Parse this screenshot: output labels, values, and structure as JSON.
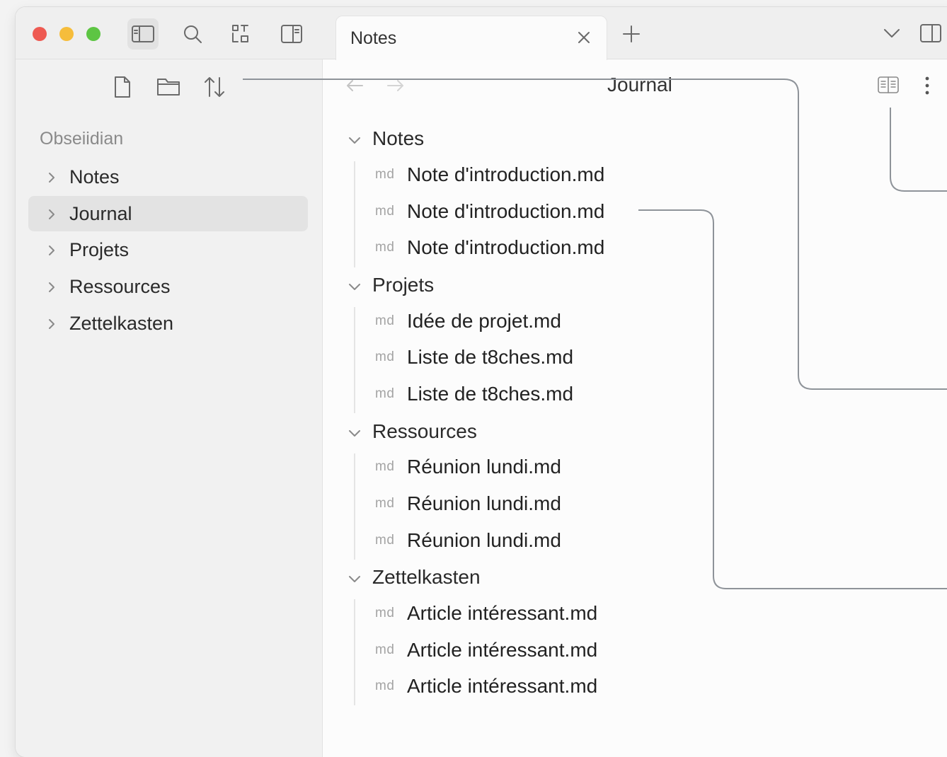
{
  "tab": {
    "title": "Notes"
  },
  "header": {
    "title": "Journal"
  },
  "sidebar": {
    "vault_name": "Obseiidian",
    "items": [
      {
        "label": "Notes",
        "selected": false
      },
      {
        "label": "Journal",
        "selected": true
      },
      {
        "label": "Projets",
        "selected": false
      },
      {
        "label": "Ressources",
        "selected": false
      },
      {
        "label": "Zettelkasten",
        "selected": false
      }
    ]
  },
  "tree": [
    {
      "folder": "Notes",
      "files": [
        {
          "ext": "md",
          "name": "Note d'introduction.md"
        },
        {
          "ext": "md",
          "name": "Note d'introduction.md"
        },
        {
          "ext": "md",
          "name": "Note d'introduction.md"
        }
      ]
    },
    {
      "folder": "Projets",
      "files": [
        {
          "ext": "md",
          "name": "Idée de projet.md"
        },
        {
          "ext": "md",
          "name": "Liste de t8ches.md"
        },
        {
          "ext": "md",
          "name": "Liste de t8ches.md"
        }
      ]
    },
    {
      "folder": "Ressources",
      "files": [
        {
          "ext": "md",
          "name": "Réunion lundi.md"
        },
        {
          "ext": "md",
          "name": "Réunion lundi.md"
        },
        {
          "ext": "md",
          "name": "Réunion lundi.md"
        }
      ]
    },
    {
      "folder": "Zettelkasten",
      "files": [
        {
          "ext": "md",
          "name": "Article intéressant.md"
        },
        {
          "ext": "md",
          "name": "Article intéressant.md"
        },
        {
          "ext": "md",
          "name": "Article intéressant.md"
        }
      ]
    }
  ],
  "icons": {
    "titlebar": [
      "sidebar-toggle-icon",
      "search-icon",
      "bookmarks-icon",
      "layout-icon"
    ],
    "sidebar_toolbar": [
      "new-note-icon",
      "new-folder-icon",
      "sort-icon"
    ],
    "right": [
      "chevron-down-icon",
      "right-sidebar-icon",
      "reading-view-icon",
      "more-options-icon"
    ]
  },
  "colors": {
    "close": "#ee5a52",
    "minimize": "#f6bd3b",
    "maximize": "#5dc543",
    "selected_bg": "#e3e3e3"
  }
}
